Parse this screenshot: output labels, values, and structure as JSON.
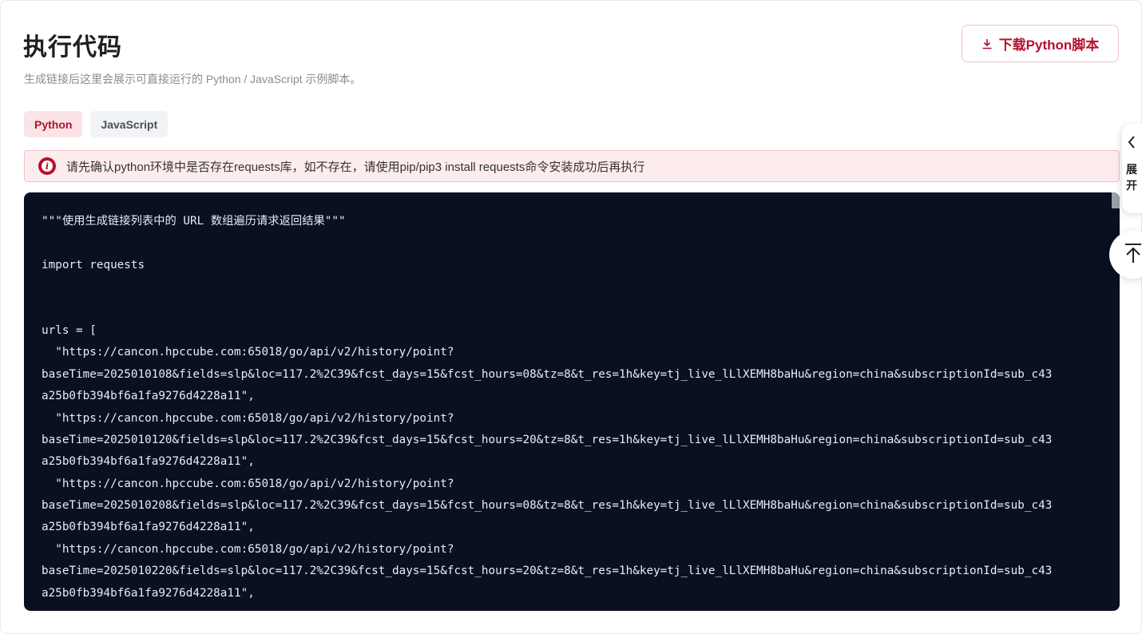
{
  "header": {
    "title": "执行代码",
    "subtitle": "生成链接后这里会展示可直接运行的 Python / JavaScript 示例脚本。",
    "download_label": "下载Python脚本"
  },
  "tabs": [
    {
      "label": "Python",
      "active": true
    },
    {
      "label": "JavaScript",
      "active": false
    }
  ],
  "alert": {
    "text": "请先确认python环境中是否存在requests库，如不存在，请使用pip/pip3 install requests命令安装成功后再执行"
  },
  "code": {
    "lines": [
      "\"\"\"使用生成链接列表中的 URL 数组遍历请求返回结果\"\"\"",
      "",
      "import requests",
      "",
      "",
      "urls = [",
      "  \"https://cancon.hpccube.com:65018/go/api/v2/history/point?",
      "baseTime=2025010108&fields=slp&loc=117.2%2C39&fcst_days=15&fcst_hours=08&tz=8&t_res=1h&key=tj_live_lLlXEMH8baHu&region=china&subscriptionId=sub_c43",
      "a25b0fb394bf6a1fa9276d4228a11\",",
      "  \"https://cancon.hpccube.com:65018/go/api/v2/history/point?",
      "baseTime=2025010120&fields=slp&loc=117.2%2C39&fcst_days=15&fcst_hours=20&tz=8&t_res=1h&key=tj_live_lLlXEMH8baHu&region=china&subscriptionId=sub_c43",
      "a25b0fb394bf6a1fa9276d4228a11\",",
      "  \"https://cancon.hpccube.com:65018/go/api/v2/history/point?",
      "baseTime=2025010208&fields=slp&loc=117.2%2C39&fcst_days=15&fcst_hours=08&tz=8&t_res=1h&key=tj_live_lLlXEMH8baHu&region=china&subscriptionId=sub_c43",
      "a25b0fb394bf6a1fa9276d4228a11\",",
      "  \"https://cancon.hpccube.com:65018/go/api/v2/history/point?",
      "baseTime=2025010220&fields=slp&loc=117.2%2C39&fcst_days=15&fcst_hours=20&tz=8&t_res=1h&key=tj_live_lLlXEMH8baHu&region=china&subscriptionId=sub_c43",
      "a25b0fb394bf6a1fa9276d4228a11\","
    ]
  },
  "side": {
    "expand_label": "展开",
    "expand_icon": "chevron-left-icon",
    "back_top_icon": "back-to-top-icon"
  },
  "colors": {
    "accent": "#b5102f",
    "code_bg": "#0b1020",
    "alert_bg": "#fdecee"
  }
}
